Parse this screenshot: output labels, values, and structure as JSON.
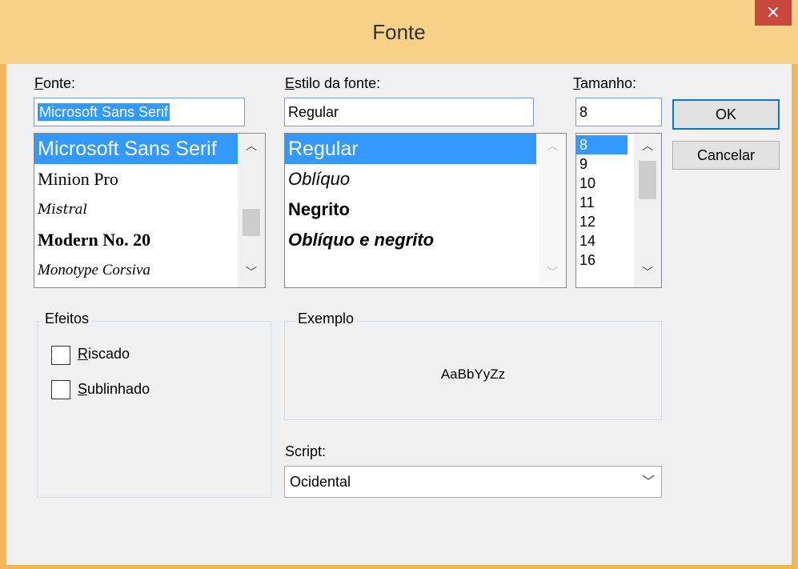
{
  "window": {
    "title": "Fonte",
    "close_glyph": "×"
  },
  "font": {
    "label": "Fonte:",
    "value": "Microsoft Sans Serif",
    "items": [
      "Microsoft Sans Serif",
      "Minion Pro",
      "Mistral",
      "Modern No. 20",
      "Monotype Corsiva"
    ]
  },
  "style": {
    "label": "Estilo da fonte:",
    "value": "Regular",
    "items": [
      "Regular",
      "Oblíquo",
      "Negrito",
      "Oblíquo e negrito"
    ]
  },
  "size": {
    "label": "Tamanho:",
    "value": "8",
    "items": [
      "8",
      "9",
      "10",
      "11",
      "12",
      "14",
      "16"
    ]
  },
  "buttons": {
    "ok": "OK",
    "cancel": "Cancelar"
  },
  "effects": {
    "title": "Efeitos",
    "strikeout": "Riscado",
    "underline": "Sublinhado"
  },
  "sample": {
    "title": "Exemplo",
    "text": "AaBbYyZz"
  },
  "script": {
    "label": "Script:",
    "value": "Ocidental"
  },
  "icons": {
    "scroll_up": "scroll-up-icon",
    "scroll_down": "scroll-down-icon",
    "dropdown": "chevron-down-icon",
    "close": "close-icon"
  },
  "colors": {
    "title_bar": "#f8d188",
    "frame": "#f4b557",
    "selection": "#3399ff",
    "close": "#c7463e"
  }
}
